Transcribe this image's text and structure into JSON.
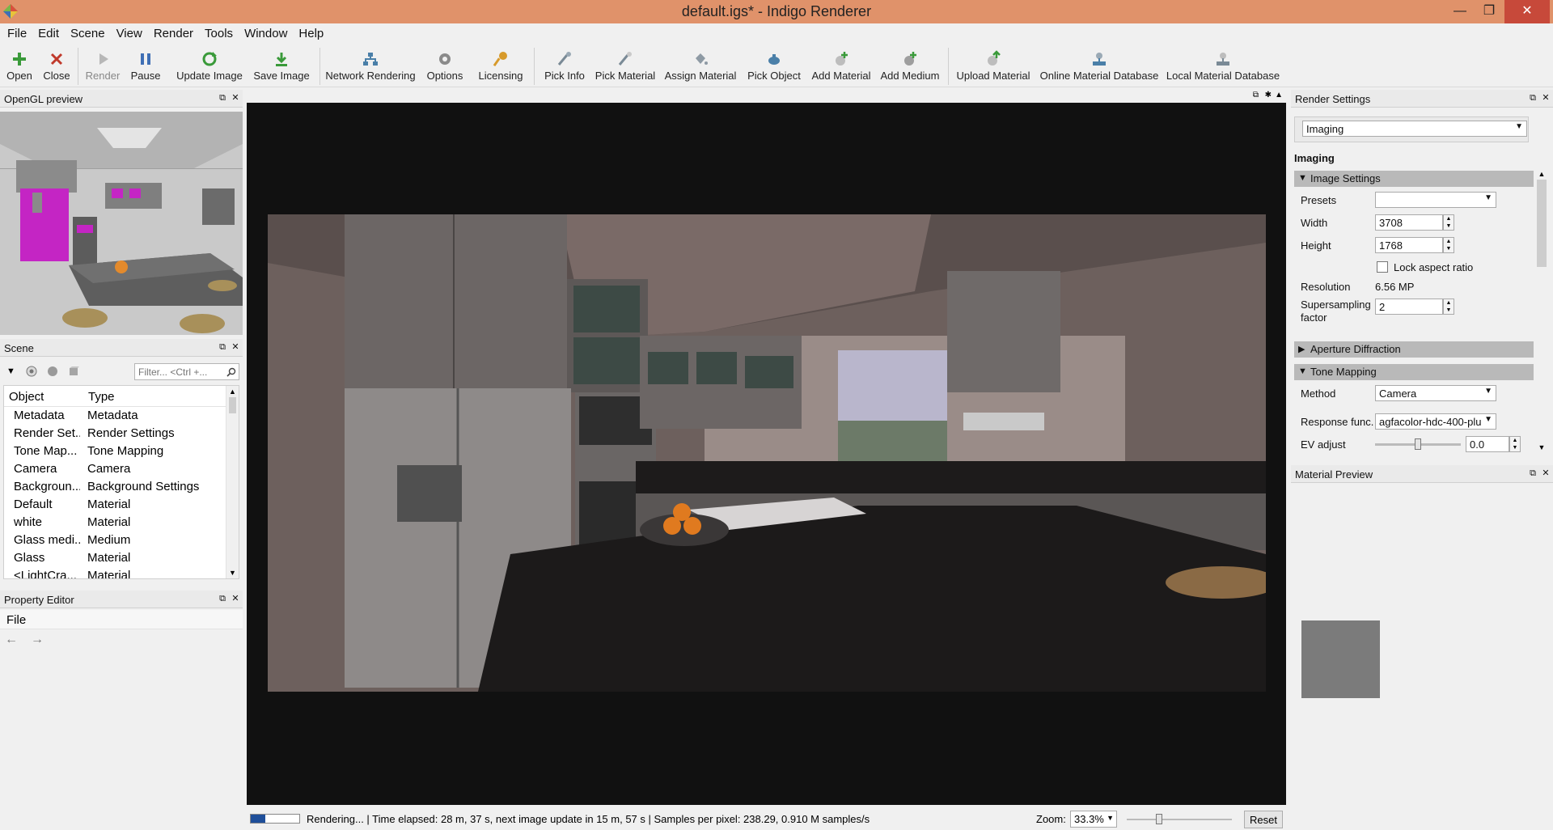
{
  "window": {
    "title": "default.igs* - Indigo Renderer"
  },
  "menu": [
    "File",
    "Edit",
    "Scene",
    "View",
    "Render",
    "Tools",
    "Window",
    "Help"
  ],
  "toolbar": {
    "open": "Open",
    "close": "Close",
    "render": "Render",
    "pause": "Pause",
    "update_image": "Update Image",
    "save_image": "Save Image",
    "network_rendering": "Network Rendering",
    "options": "Options",
    "licensing": "Licensing",
    "pick_info": "Pick Info",
    "pick_material": "Pick Material",
    "assign_material": "Assign Material",
    "pick_object": "Pick Object",
    "add_material": "Add Material",
    "add_medium": "Add Medium",
    "upload_material": "Upload Material",
    "online_db": "Online Material Database",
    "local_db": "Local Material Database"
  },
  "opengl_panel": {
    "title": "OpenGL preview"
  },
  "scene_panel": {
    "title": "Scene",
    "filter_placeholder": "Filter... <Ctrl +...",
    "columns": {
      "object": "Object",
      "type": "Type"
    },
    "rows": [
      {
        "object": "Metadata",
        "type": "Metadata"
      },
      {
        "object": "Render Set...",
        "type": "Render Settings"
      },
      {
        "object": "Tone Map...",
        "type": "Tone Mapping"
      },
      {
        "object": "Camera",
        "type": "Camera"
      },
      {
        "object": "Backgroun...",
        "type": "Background Settings"
      },
      {
        "object": "Default",
        "type": "Material"
      },
      {
        "object": "white",
        "type": "Material"
      },
      {
        "object": "Glass medi...",
        "type": "Medium"
      },
      {
        "object": "Glass",
        "type": "Material"
      },
      {
        "object": "<LightCra...",
        "type": "Material"
      }
    ]
  },
  "property_panel": {
    "title": "Property Editor",
    "section": "File"
  },
  "render_settings": {
    "title": "Render Settings",
    "category_select": "Imaging",
    "heading": "Imaging",
    "image_settings": {
      "title": "Image Settings",
      "presets_label": "Presets",
      "presets_value": "",
      "width_label": "Width",
      "width": "3708",
      "height_label": "Height",
      "height": "1768",
      "lock_label": "Lock aspect ratio",
      "lock_checked": false,
      "resolution_label": "Resolution",
      "resolution": "6.56 MP",
      "supersampling_label_1": "Supersampling",
      "supersampling_label_2": "factor",
      "supersampling": "2"
    },
    "aperture": {
      "title": "Aperture Diffraction"
    },
    "tone_mapping": {
      "title": "Tone Mapping",
      "method_label": "Method",
      "method": "Camera",
      "response_label": "Response func.",
      "response": "agfacolor-hdc-400-plu",
      "ev_label": "EV adjust",
      "ev": "0.0",
      "ev_slider_fraction": 0.5
    }
  },
  "material_preview": {
    "title": "Material Preview"
  },
  "status": {
    "progress_fraction": 0.3,
    "text": "Rendering... | Time elapsed: 28 m, 37 s, next image update in 15 m, 57 s | Samples per pixel: 238.29, 0.910 M samples/s",
    "zoom_label": "Zoom:",
    "zoom_value": "33.3%",
    "reset": "Reset"
  },
  "colors": {
    "titlebar": "#e0926a",
    "close_button": "#c7493a",
    "section_header": "#b9b9b9"
  }
}
